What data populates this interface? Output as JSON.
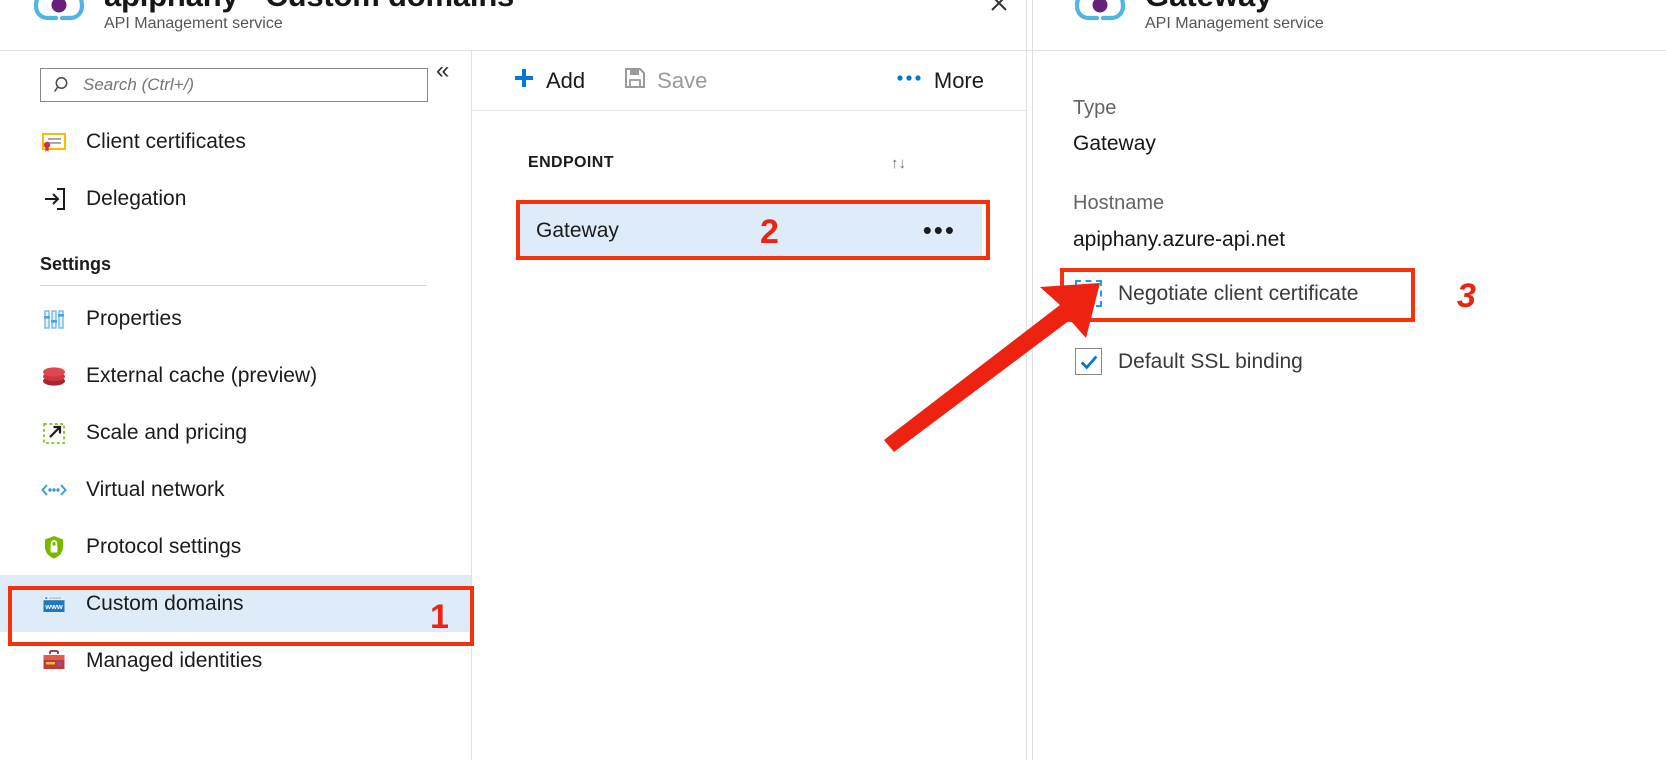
{
  "blade": {
    "icon": "api-management-icon",
    "title": "apiphany - Custom domains",
    "subtitle": "API Management service",
    "close_label": "✕"
  },
  "search": {
    "placeholder": "Search (Ctrl+/)",
    "value": "",
    "icon": "search-icon",
    "collapse_icon": "«"
  },
  "sidebar": {
    "items": [
      {
        "label": "Client certificates",
        "icon": "certificate-icon",
        "selected": false
      },
      {
        "label": "Delegation",
        "icon": "delegation-icon",
        "selected": false
      }
    ],
    "group_label": "Settings",
    "settings_items": [
      {
        "label": "Properties",
        "icon": "properties-icon",
        "selected": false
      },
      {
        "label": "External cache (preview)",
        "icon": "cache-icon",
        "selected": false
      },
      {
        "label": "Scale and pricing",
        "icon": "scale-icon",
        "selected": false
      },
      {
        "label": "Virtual network",
        "icon": "virtual-network-icon",
        "selected": false
      },
      {
        "label": "Protocol settings",
        "icon": "shield-lock-icon",
        "selected": false
      },
      {
        "label": "Custom domains",
        "icon": "www-icon",
        "selected": true
      },
      {
        "label": "Managed identities",
        "icon": "briefcase-icon",
        "selected": false
      }
    ]
  },
  "toolbar": {
    "add_label": "Add",
    "add_icon": "plus-icon",
    "save_label": "Save",
    "save_icon": "save-icon",
    "save_disabled": true,
    "more_label": "More",
    "more_icon": "ellipsis-icon"
  },
  "table": {
    "column_header": "ENDPOINT",
    "sort_icon": "↑↓",
    "rows": [
      {
        "endpoint": "Gateway",
        "menu_icon": "•••",
        "selected": true
      }
    ]
  },
  "detail": {
    "icon": "api-management-icon",
    "title": "Gateway",
    "subtitle": "API Management service",
    "type_label": "Type",
    "type_value": "Gateway",
    "hostname_label": "Hostname",
    "hostname_value": "apiphany.azure-api.net",
    "checkboxes": [
      {
        "label": "Negotiate client certificate",
        "checked": false,
        "focused": true
      },
      {
        "label": "Default SSL binding",
        "checked": true,
        "focused": false
      }
    ]
  },
  "annotations": {
    "step1": "1",
    "step2": "2",
    "step3": "3",
    "highlight_color": "#f5320c",
    "arrow_color": "#ee2211"
  }
}
